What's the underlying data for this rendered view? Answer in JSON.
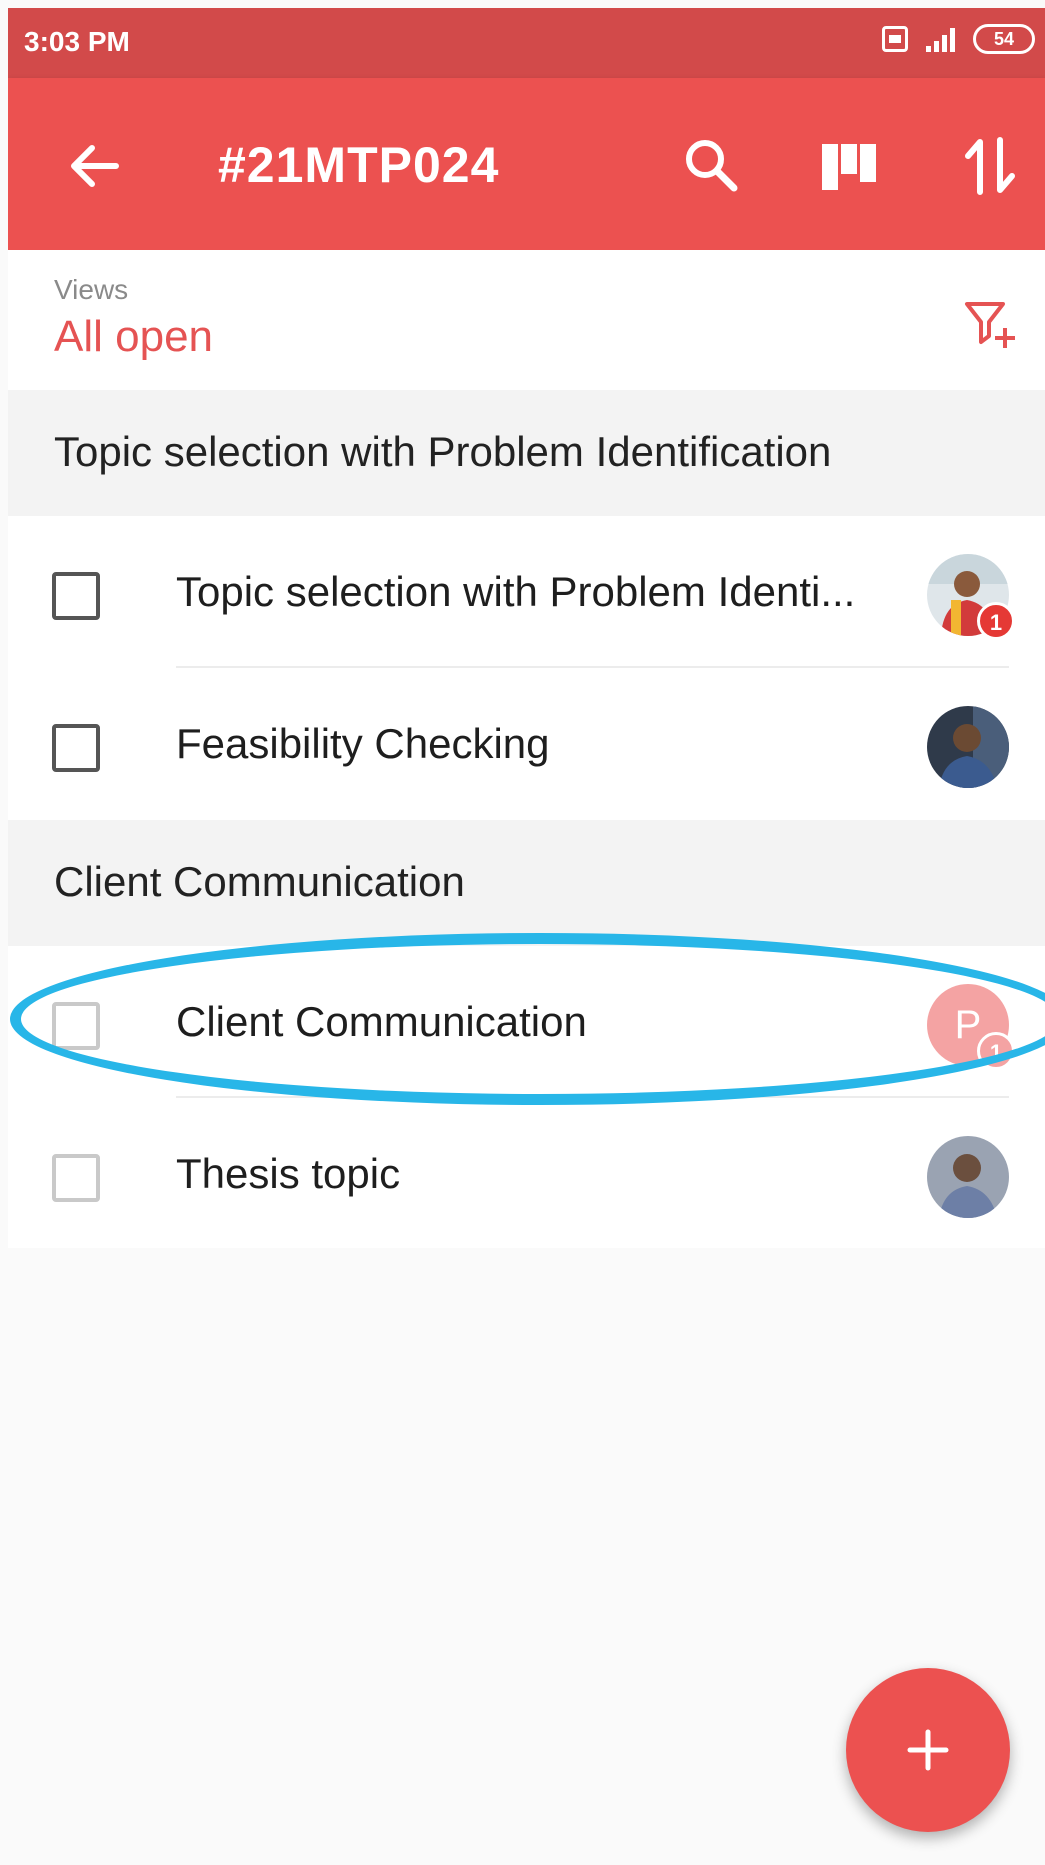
{
  "status_bar": {
    "time": "3:03 PM",
    "battery": "54",
    "icons": [
      "sim-icon",
      "signal-icon",
      "battery-icon"
    ]
  },
  "app_bar": {
    "title": "#21MTP024",
    "icons": [
      "back-arrow-icon",
      "search-icon",
      "board-view-icon",
      "sort-icon"
    ],
    "color": "#ec5150"
  },
  "views": {
    "label": "Views",
    "value": "All open",
    "icon": "filter-add-icon"
  },
  "sections": [
    {
      "title": "Topic selection with Problem Identification",
      "tasks": [
        {
          "title": "Topic selection with Problem Identi...",
          "badge": "1",
          "avatar": "avatar-photo"
        },
        {
          "title": "Feasibility Checking",
          "badge": "",
          "avatar": "avatar-photo"
        }
      ]
    },
    {
      "title": "Client Communication",
      "tasks": [
        {
          "title": "Client Communication",
          "badge": "1",
          "avatar": "avatar-initial",
          "avatar_initial": "P"
        },
        {
          "title": "Thesis topic",
          "badge": "",
          "avatar": "avatar-photo"
        }
      ]
    }
  ],
  "fab": {
    "icon": "plus-icon"
  },
  "annotation": {
    "type": "highlight-ellipse",
    "color": "#28b6e8"
  }
}
